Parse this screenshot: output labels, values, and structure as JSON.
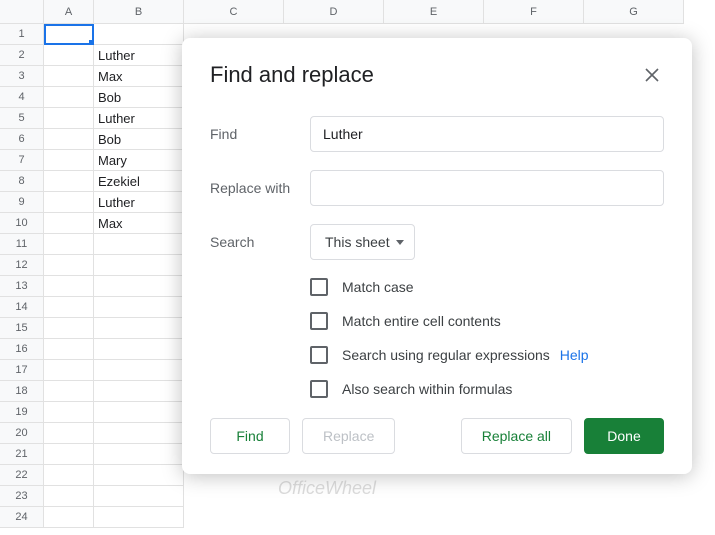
{
  "columns": [
    "A",
    "B",
    "C",
    "D",
    "E",
    "F",
    "G"
  ],
  "rows": {
    "count": 24,
    "data": {
      "2": "Luther",
      "3": "Max",
      "4": "Bob",
      "5": "Luther",
      "6": "Bob",
      "7": "Mary",
      "8": "Ezekiel",
      "9": "Luther",
      "10": "Max"
    }
  },
  "dialog": {
    "title": "Find and replace",
    "find_label": "Find",
    "find_value": "Luther",
    "replace_label": "Replace with",
    "replace_value": "",
    "search_label": "Search",
    "search_scope": "This sheet",
    "checks": {
      "match_case": "Match case",
      "match_entire": "Match entire cell contents",
      "regex": "Search using regular expressions",
      "help": "Help",
      "formulas": "Also search within formulas"
    },
    "buttons": {
      "find": "Find",
      "replace": "Replace",
      "replace_all": "Replace all",
      "done": "Done"
    }
  },
  "watermark": "OfficeWheel"
}
